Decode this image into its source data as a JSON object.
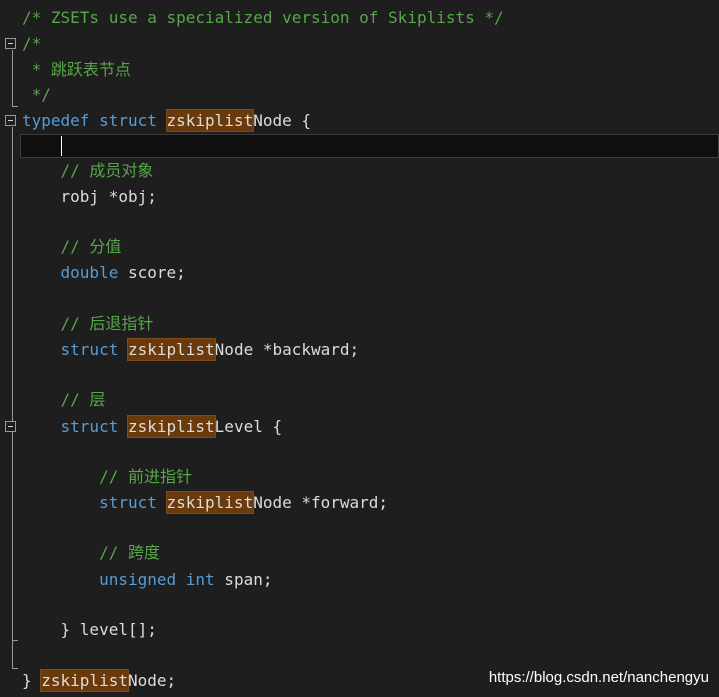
{
  "editor": {
    "lines": [
      {
        "text": "/* ZSETs use a specialized version of Skiplists */"
      },
      {
        "text": "/*"
      },
      {
        "text": " * 跳跃表节点"
      },
      {
        "text": " */"
      },
      {
        "kw": "typedef struct",
        "hl": "zskiplist",
        "rest": "Node {"
      },
      {
        "text": ""
      },
      {
        "text": "    // 成员对象"
      },
      {
        "text": "    robj *obj;"
      },
      {
        "text": ""
      },
      {
        "text": "    // 分值"
      },
      {
        "kw": "double",
        "rest": " score;"
      },
      {
        "text": ""
      },
      {
        "text": "    // 后退指针"
      },
      {
        "kw": "struct",
        "hl": "zskiplist",
        "rest": "Node *backward;"
      },
      {
        "text": ""
      },
      {
        "text": "    // 层"
      },
      {
        "kw": "struct",
        "hl": "zskiplist",
        "rest": "Level {"
      },
      {
        "text": ""
      },
      {
        "text": "        // 前进指针"
      },
      {
        "kw": "struct",
        "hl": "zskiplist",
        "rest": "Node *forward;"
      },
      {
        "text": ""
      },
      {
        "text": "        // 跨度"
      },
      {
        "kw1": "unsigned",
        "kw2": "int",
        "rest": " span;"
      },
      {
        "text": ""
      },
      {
        "text": "    } level[];"
      },
      {
        "text": ""
      },
      {
        "text": "} ",
        "hl": "zskiplist",
        "rest": "Node;"
      }
    ]
  },
  "watermark": "https://blog.csdn.net/nanchengyu",
  "colors": {
    "background": "#1e1e1e",
    "comment": "#57a64a",
    "keyword": "#569cd6",
    "text": "#dcdcdc",
    "highlight": "#6b3a0c"
  }
}
